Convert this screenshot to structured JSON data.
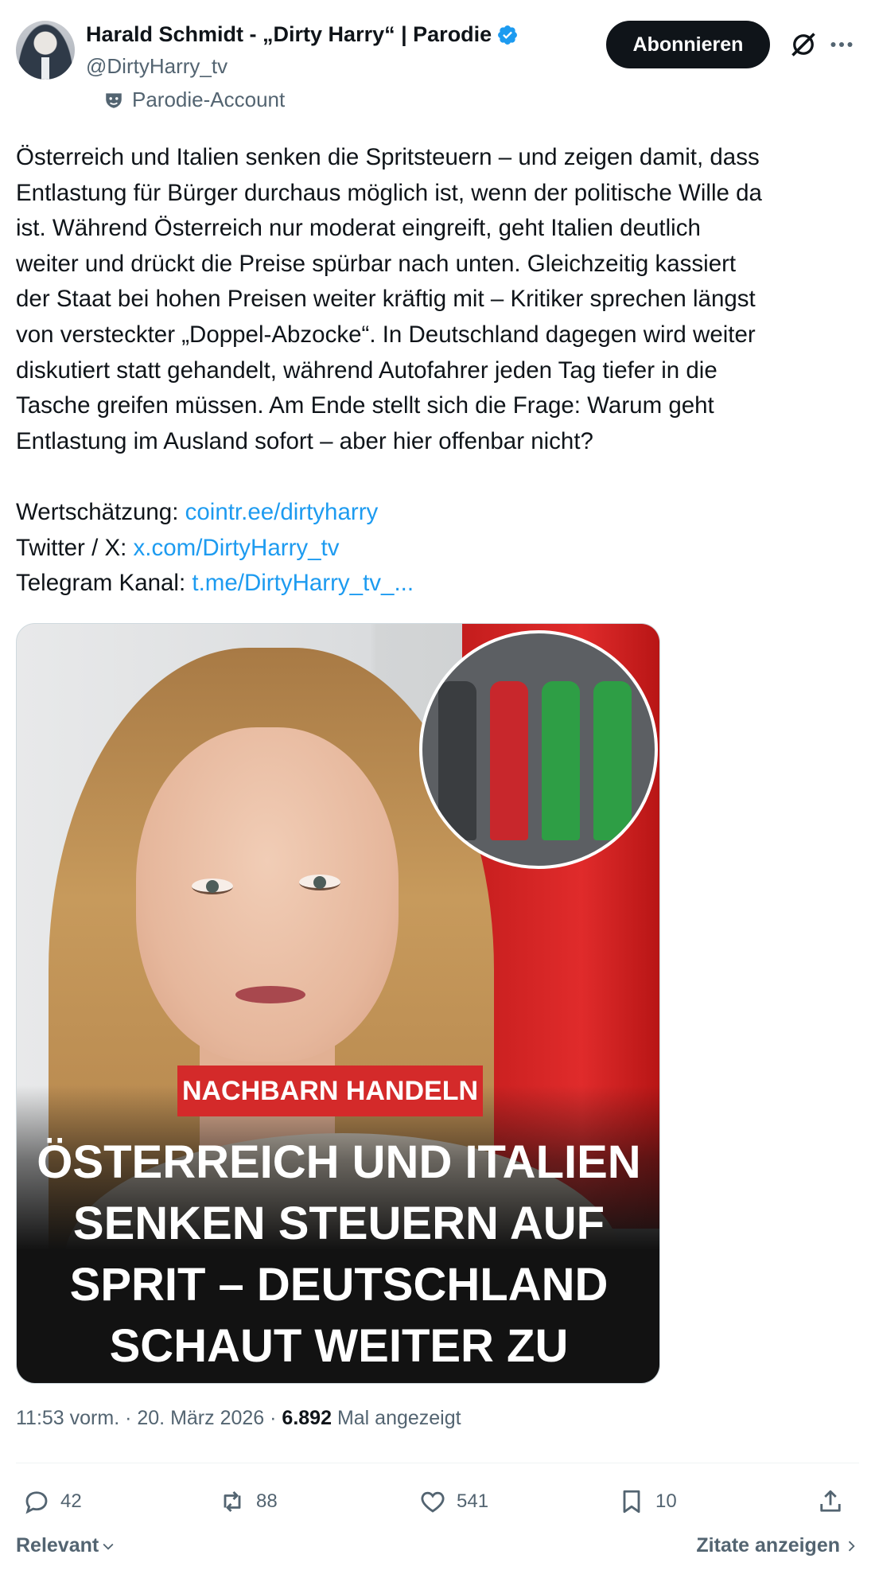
{
  "author": {
    "display_name": "Harald Schmidt - „Dirty Harry“ | Parodie",
    "handle": "@DirtyHarry_tv",
    "account_label": "Parodie-Account",
    "verified": true
  },
  "header": {
    "subscribe_label": "Abonnieren"
  },
  "tweet": {
    "lines": [
      "Österreich  und Italien senken die Spritsteuern – und zeigen damit, dass",
      "Entlastung  für Bürger durchaus möglich ist, wenn der politische Wille da",
      "ist.  Während Österreich nur moderat eingreift, geht Italien deutlich",
      "weiter  und drückt die Preise spürbar nach unten. Gleichzeitig kassiert",
      "der  Staat bei hohen Preisen weiter kräftig mit – Kritiker sprechen längst",
      "von versteckter „Doppel-Abzocke“. In Deutschland dagegen wird weiter",
      "diskutiert statt gehandelt, während Autofahrer jeden Tag tiefer in die",
      "Tasche greifen müssen. Am Ende stellt sich die Frage: Warum geht",
      "Entlastung im Ausland sofort – aber hier offenbar nicht?"
    ],
    "links": [
      {
        "prefix": "Wertschätzung: ",
        "text": "cointr.ee/dirtyharry"
      },
      {
        "prefix": "Twitter / X: ",
        "text": "x.com/DirtyHarry_tv"
      },
      {
        "prefix": "Telegram Kanal: ",
        "text": "t.me/DirtyHarry_tv_..."
      }
    ]
  },
  "media": {
    "banner": "NACHBARN HANDELN",
    "headline_lines": [
      "ÖSTERREICH UND ITALIEN",
      "SENKEN STEUERN AUF",
      "SPRIT – DEUTSCHLAND",
      "SCHAUT WEITER ZU"
    ]
  },
  "meta": {
    "time": "11:53 vorm.",
    "date": "20. März 2026",
    "views": "6.892",
    "views_suffix": "Mal angezeigt"
  },
  "actions": {
    "replies": "42",
    "reposts": "88",
    "likes": "541",
    "bookmarks": "10"
  },
  "footer": {
    "sort_label": "Relevant",
    "quotes_label": "Zitate anzeigen"
  },
  "colors": {
    "text": "#0f1419",
    "secondary": "#536471",
    "link": "#1d9bf0",
    "button_bg": "#0f1419",
    "banner_red": "#d42a2a"
  }
}
